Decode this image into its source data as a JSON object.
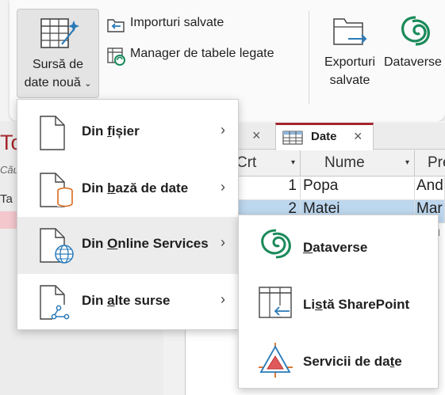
{
  "ribbon": {
    "new_source": {
      "label_line1": "Sursă de",
      "label_line2": "date nouă",
      "chevron": "⌄",
      "icon": "table-sparkle-icon"
    },
    "saved_imports": {
      "label": "Importuri salvate",
      "icon": "saved-imports-icon"
    },
    "linked_table_manager": {
      "label": "Manager de tabele legate",
      "icon": "linked-table-manager-icon"
    },
    "saved_exports": {
      "label_line1": "Exporturi",
      "label_line2": "salvate",
      "icon": "saved-exports-icon"
    },
    "dataverse": {
      "label": "Dataverse",
      "icon": "dataverse-icon"
    }
  },
  "background": {
    "title_fragment": "To",
    "search_fragment": "Căut",
    "tables_fragment": "Ta",
    "tab_prev_close": "×",
    "tab_active": {
      "label": "Date",
      "close": "×",
      "icon": "table-icon"
    },
    "columns": [
      {
        "label": "Crt",
        "dropdown": "▾"
      },
      {
        "label": "Nume",
        "dropdown": "▾"
      },
      {
        "label": "Pre",
        "dropdown": ""
      }
    ],
    "rows": [
      {
        "crt": "1",
        "nume": "Popa",
        "pre": "And"
      },
      {
        "crt": "2",
        "nume": "Matei",
        "pre": "Mar"
      }
    ],
    "row3_fragment": "m"
  },
  "menu": {
    "items": [
      {
        "pre": "Din ",
        "underlined": "f",
        "post": "ișier",
        "icon": "file-icon",
        "arrow": "›"
      },
      {
        "pre": "Din ",
        "underlined": "b",
        "post": "ază de date",
        "icon": "database-file-icon",
        "arrow": "›"
      },
      {
        "pre": "Din ",
        "underlined": "O",
        "post": "nline Services",
        "icon": "online-services-icon",
        "arrow": "›"
      },
      {
        "pre": "Din ",
        "underlined": "a",
        "post": "lte surse",
        "icon": "other-sources-icon",
        "arrow": "›"
      }
    ]
  },
  "submenu": {
    "items": [
      {
        "pre": "",
        "underlined": "D",
        "post": "ataverse",
        "icon": "dataverse-icon"
      },
      {
        "pre": "Li",
        "underlined": "s",
        "post": "tă SharePoint",
        "icon": "sharepoint-list-icon"
      },
      {
        "pre": "Servicii de da",
        "underlined": "t",
        "post": "e",
        "icon": "data-services-icon"
      }
    ]
  },
  "colors": {
    "accent": "#a4262c",
    "selection": "#bdd7ee",
    "dataverse_green": "#1a8a5a",
    "link_blue": "#2a7ab8",
    "db_orange": "#d86b1f"
  }
}
